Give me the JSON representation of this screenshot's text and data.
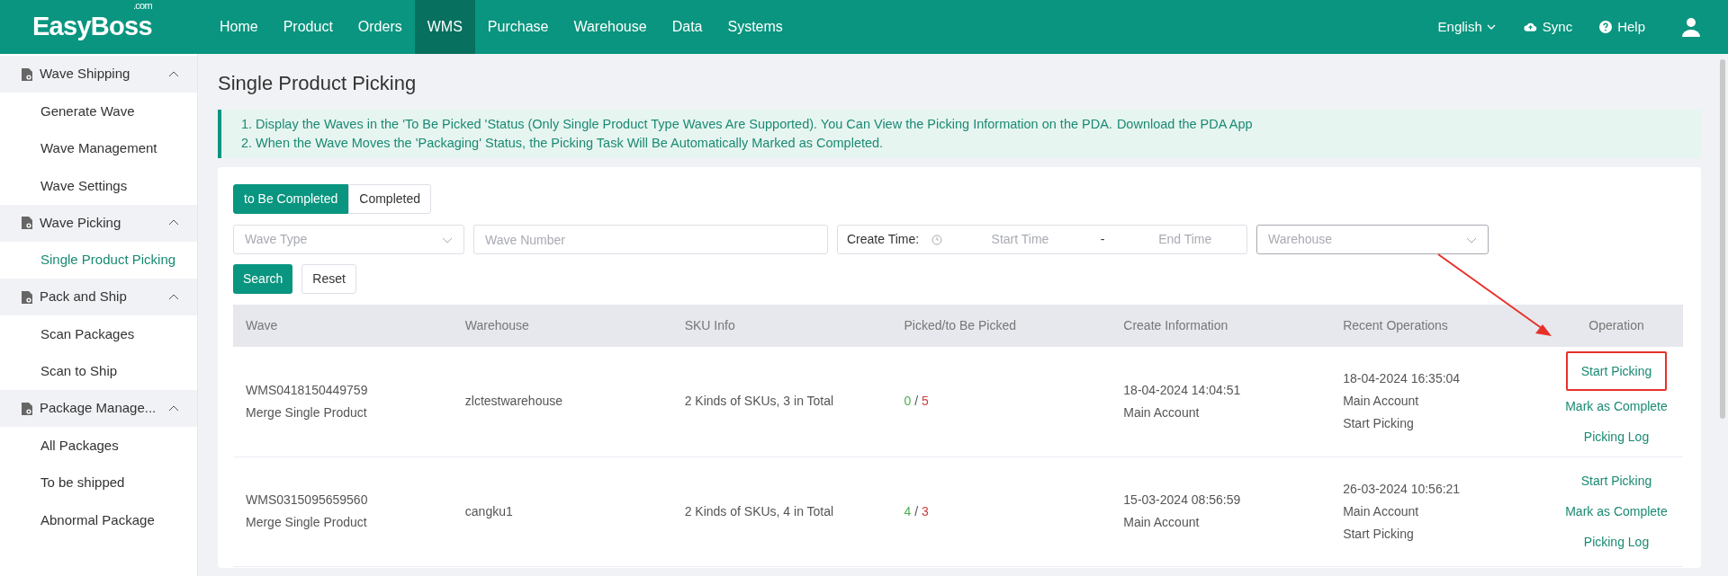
{
  "header": {
    "logo": "EasyBoss",
    "logo_suffix": ".com",
    "nav": [
      {
        "label": "Home",
        "selected": false
      },
      {
        "label": "Product",
        "selected": false
      },
      {
        "label": "Orders",
        "selected": false
      },
      {
        "label": "WMS",
        "selected": true
      },
      {
        "label": "Purchase",
        "selected": false
      },
      {
        "label": "Warehouse",
        "selected": false
      },
      {
        "label": "Data",
        "selected": false
      },
      {
        "label": "Systems",
        "selected": false
      }
    ],
    "language": "English",
    "sync": "Sync",
    "help": "Help"
  },
  "sidebar": [
    {
      "label": "Wave Shipping",
      "expanded": true,
      "children": [
        {
          "label": "Generate Wave",
          "selected": false
        },
        {
          "label": "Wave Management",
          "selected": false
        },
        {
          "label": "Wave Settings",
          "selected": false
        }
      ]
    },
    {
      "label": "Wave Picking",
      "expanded": true,
      "children": [
        {
          "label": "Single Product Picking",
          "selected": true
        }
      ]
    },
    {
      "label": "Pack and Ship",
      "expanded": true,
      "children": [
        {
          "label": "Scan Packages",
          "selected": false
        },
        {
          "label": "Scan to Ship",
          "selected": false
        }
      ]
    },
    {
      "label": "Package Manage...",
      "expanded": true,
      "children": [
        {
          "label": "All Packages",
          "selected": false
        },
        {
          "label": "To be shipped",
          "selected": false
        },
        {
          "label": "Abnormal Package",
          "selected": false
        }
      ]
    }
  ],
  "page_title": "Single Product Picking",
  "notice": {
    "lines": [
      "1. Display the Waves in the 'To Be Picked 'Status (Only Single Product Type Waves Are Supported). You Can View the Picking Information on the PDA.",
      "2. When the Wave Moves the 'Packaging' Status, the Picking Task Will Be Automatically Marked as Completed."
    ],
    "link": "Download the PDA App"
  },
  "tabs": [
    {
      "label": "to Be Completed",
      "selected": true
    },
    {
      "label": "Completed",
      "selected": false
    }
  ],
  "filters": {
    "wave_type": {
      "placeholder": "Wave Type"
    },
    "wave_number": {
      "placeholder": "Wave Number"
    },
    "create_time": {
      "label": "Create Time:",
      "start_placeholder": "Start Time",
      "separator": "-",
      "end_placeholder": "End Time"
    },
    "warehouse": {
      "placeholder": "Warehouse"
    }
  },
  "buttons": {
    "search": "Search",
    "reset": "Reset"
  },
  "table": {
    "columns": [
      "Wave",
      "Warehouse",
      "SKU Info",
      "Picked/to Be Picked",
      "Create Information",
      "Recent Operations",
      "Operation"
    ],
    "rows": [
      {
        "wave_number": "WMS0418150449759",
        "wave_type": "Merge Single Product",
        "warehouse": "zlctestwarehouse",
        "sku_info": "2 Kinds of SKUs, 3 in Total",
        "picked": "0",
        "separator": "/",
        "to_be_picked": "5",
        "created_at": "18-04-2024 14:04:51",
        "created_by": "Main Account",
        "recent_time": "18-04-2024 16:35:04",
        "recent_by": "Main Account",
        "recent_action": "Start Picking",
        "operations": [
          {
            "label": "Start Picking",
            "highlighted": true
          },
          {
            "label": "Mark as Complete",
            "highlighted": false
          },
          {
            "label": "Picking Log",
            "highlighted": false
          }
        ]
      },
      {
        "wave_number": "WMS0315095659560",
        "wave_type": "Merge Single Product",
        "warehouse": "cangku1",
        "sku_info": "2 Kinds of SKUs, 4 in Total",
        "picked": "4",
        "separator": "/",
        "to_be_picked": "3",
        "created_at": "15-03-2024 08:56:59",
        "created_by": "Main Account",
        "recent_time": "26-03-2024 10:56:21",
        "recent_by": "Main Account",
        "recent_action": "Start Picking",
        "operations": [
          {
            "label": "Start Picking",
            "highlighted": false
          },
          {
            "label": "Mark as Complete",
            "highlighted": false
          },
          {
            "label": "Picking Log",
            "highlighted": false
          }
        ]
      }
    ]
  }
}
